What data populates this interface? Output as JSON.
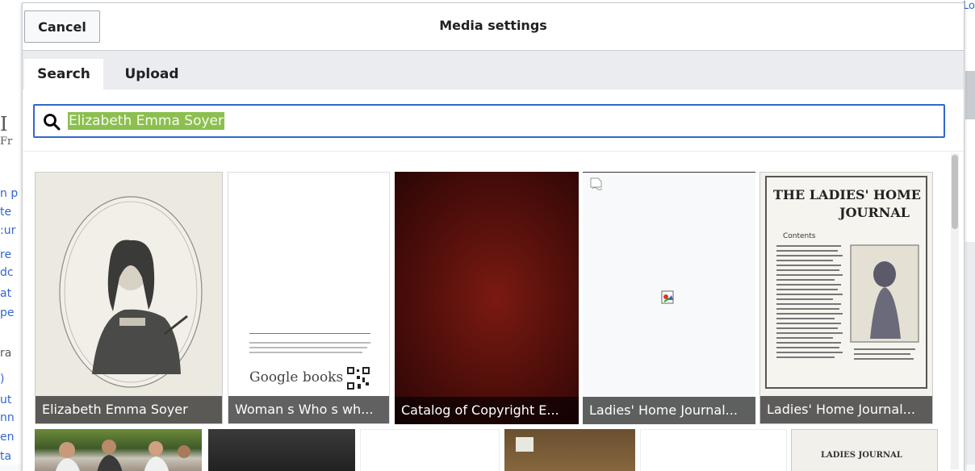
{
  "dialog": {
    "title": "Media settings",
    "cancel_label": "Cancel"
  },
  "tabs": [
    {
      "label": "Search",
      "active": true
    },
    {
      "label": "Upload",
      "active": false
    }
  ],
  "search": {
    "value": "Elizabeth Emma Soyer"
  },
  "results": [
    {
      "caption": "Elizabeth Emma Soyer"
    },
    {
      "caption": "Woman s Who s wh..."
    },
    {
      "caption": "Catalog of Copyright E..."
    },
    {
      "caption": "Ladies' Home Journal..."
    },
    {
      "caption": "Ladies' Home Journal..."
    }
  ],
  "thumb_text": {
    "google_books": "Google books",
    "journal_title_1": "THE LADIES' HOME",
    "journal_title_2": "JOURNAL",
    "journal_contents": "Contents",
    "journal_small": "LADIES JOURNAL"
  },
  "background": {
    "top_right_fragment": "Lo"
  },
  "colors": {
    "accent": "#3366cc",
    "highlight": "#8cbf4f"
  }
}
